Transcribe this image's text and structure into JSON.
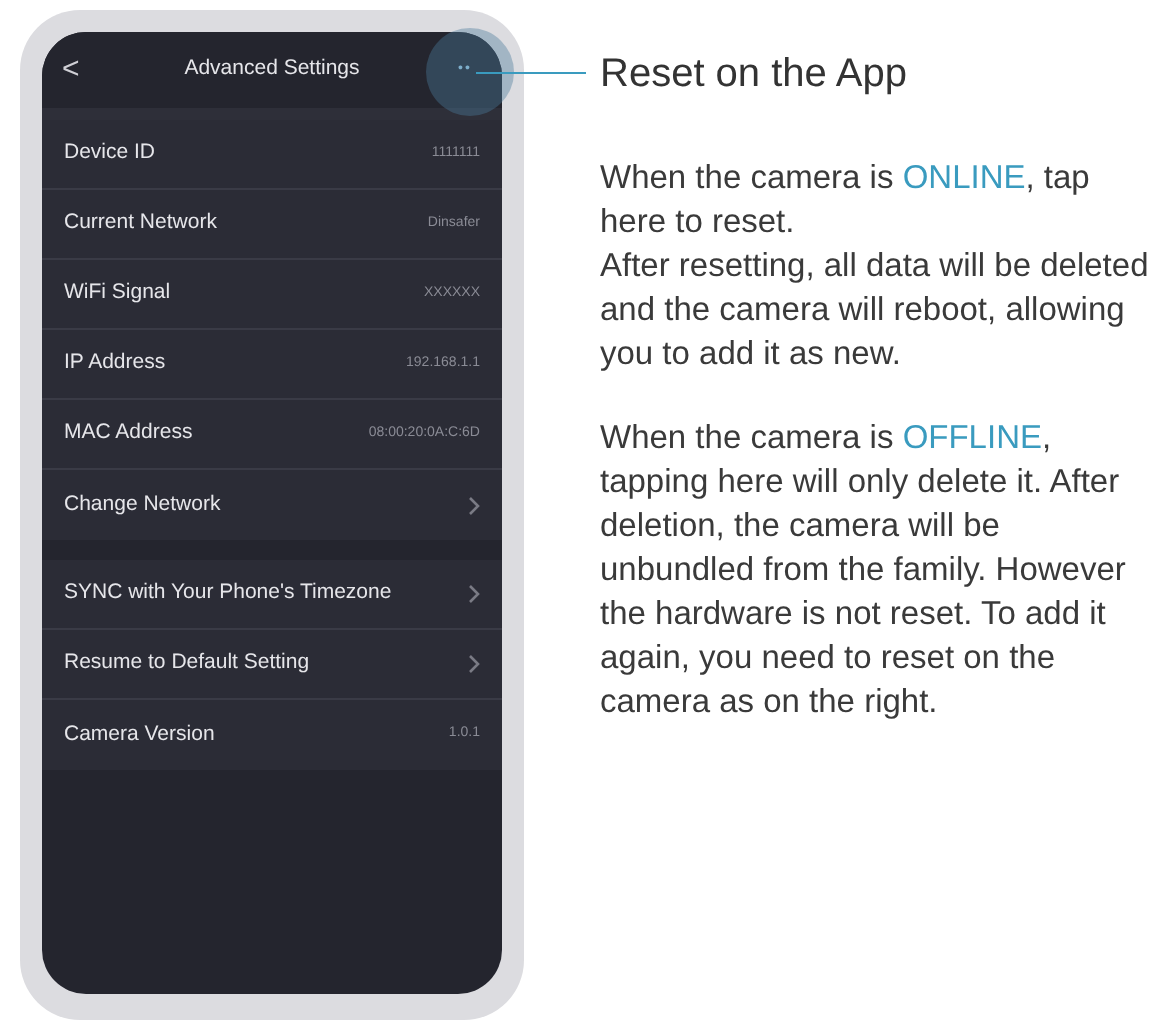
{
  "phone": {
    "header": {
      "back": "<",
      "title": "Advanced Settings",
      "more": "••"
    },
    "groups": [
      {
        "rows": [
          {
            "label": "Device ID",
            "kind": "value",
            "value": "1111111"
          },
          {
            "label": "Current Network",
            "kind": "value",
            "value": "Dinsafer"
          },
          {
            "label": "WiFi Signal",
            "kind": "value",
            "value": "XXXXXX"
          },
          {
            "label": "IP Address",
            "kind": "value",
            "value": "192.168.1.1"
          },
          {
            "label": "MAC Address",
            "kind": "value",
            "value": "08:00:20:0A:C:6D"
          },
          {
            "label": "Change Network",
            "kind": "link"
          }
        ]
      },
      {
        "rows": [
          {
            "label": "SYNC with Your Phone's Timezone",
            "kind": "link"
          },
          {
            "label": "Resume to Default Setting",
            "kind": "link"
          },
          {
            "label": "Camera Version",
            "kind": "value",
            "value": "1.0.1"
          }
        ]
      }
    ]
  },
  "callout": {
    "title": "Reset on the App",
    "sections": [
      {
        "paragraphs": [
          [
            {
              "text": "When the camera is "
            },
            {
              "text": "ONLINE",
              "highlight": true
            },
            {
              "text": ", tap here to reset."
            }
          ],
          [
            {
              "text": "After resetting, all data will be deleted and the camera will reboot, allowing you to add it as new."
            }
          ]
        ]
      },
      {
        "paragraphs": [
          [
            {
              "text": "When the camera is "
            },
            {
              "text": "OFFLINE",
              "highlight": true
            },
            {
              "text": ", tapping here will only delete it. After deletion, the camera will be unbundled from the family. However the hardware is not reset. To add it again, you need to reset on the camera as on the right."
            }
          ]
        ]
      }
    ]
  }
}
